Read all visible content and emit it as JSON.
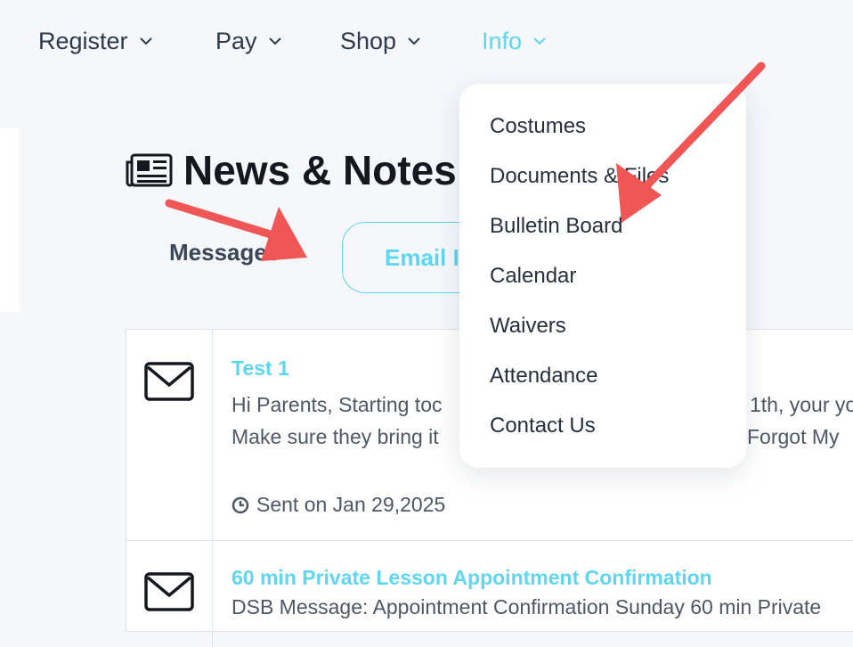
{
  "nav": {
    "items": [
      {
        "label": "Register"
      },
      {
        "label": "Pay"
      },
      {
        "label": "Shop"
      },
      {
        "label": "Info",
        "active": true
      }
    ]
  },
  "page": {
    "title": "News & Notes",
    "title_icon": "newspaper-icon"
  },
  "tabs": {
    "messages": "Messages",
    "email": "Email I"
  },
  "messages": [
    {
      "title": "Test 1",
      "body_line1": "Hi Parents, Starting toc",
      "body_line1_end": "1th, your yo",
      "body_line2": "Make sure they bring it",
      "body_line2_end": "Forgot My",
      "sent": "Sent on Jan 29,2025",
      "icon": "envelope-icon"
    },
    {
      "title": "60 min Private Lesson Appointment Confirmation",
      "body_line1": "DSB Message: Appointment Confirmation Sunday 60 min Private",
      "icon": "envelope-icon"
    }
  ],
  "dropdown": {
    "items": [
      "Costumes",
      "Documents & Files",
      "Bulletin Board",
      "Calendar",
      "Waivers",
      "Attendance",
      "Contact Us"
    ]
  },
  "colors": {
    "accent": "#5fd6ef",
    "arrow": "#f05656",
    "text_dark": "#15191f",
    "background": "#f5f7fb"
  }
}
